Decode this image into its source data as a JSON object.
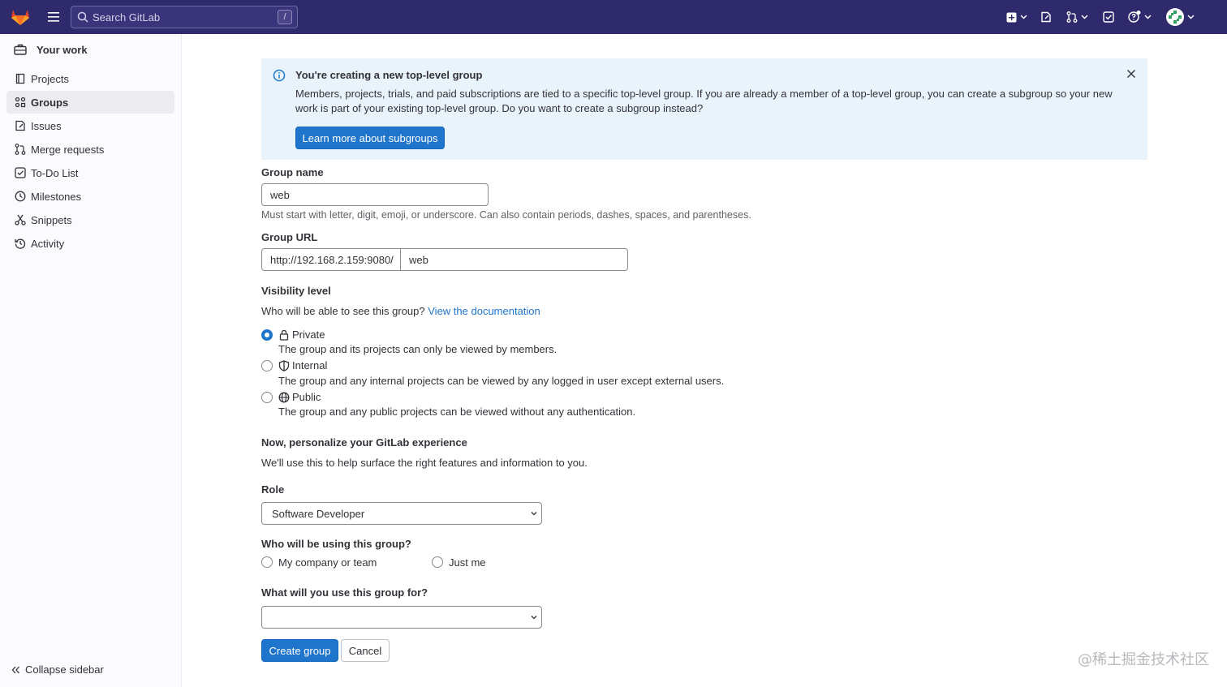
{
  "topbar": {
    "search_placeholder": "Search GitLab",
    "search_shortcut": "/",
    "icons": [
      "gitlab-logo",
      "hamburger-icon",
      "plus-square-icon",
      "issues-icon",
      "merge-request-icon",
      "todo-icon",
      "help-icon",
      "avatar"
    ]
  },
  "sidebar": {
    "header": "Your work",
    "items": [
      {
        "label": "Projects",
        "icon": "project-icon"
      },
      {
        "label": "Groups",
        "icon": "group-icon",
        "active": true
      },
      {
        "label": "Issues",
        "icon": "issues-icon"
      },
      {
        "label": "Merge requests",
        "icon": "merge-request-icon"
      },
      {
        "label": "To-Do List",
        "icon": "todo-icon"
      },
      {
        "label": "Milestones",
        "icon": "clock-icon"
      },
      {
        "label": "Snippets",
        "icon": "snippet-icon"
      },
      {
        "label": "Activity",
        "icon": "history-icon"
      }
    ],
    "collapse_label": "Collapse sidebar"
  },
  "alert": {
    "title": "You're creating a new top-level group",
    "body": "Members, projects, trials, and paid subscriptions are tied to a specific top-level group. If you are already a member of a top-level group, you can create a subgroup so your new work is part of your existing top-level group. Do you want to create a subgroup instead?",
    "button": "Learn more about subgroups"
  },
  "form": {
    "group_name_label": "Group name",
    "group_name_value": "web",
    "group_name_help": "Must start with letter, digit, emoji, or underscore. Can also contain periods, dashes, spaces, and parentheses.",
    "group_url_label": "Group URL",
    "group_url_prefix": "http://192.168.2.159:9080/",
    "group_url_value": "web",
    "visibility_label": "Visibility level",
    "visibility_question": "Who will be able to see this group?",
    "visibility_link": "View the documentation",
    "visibility_options": [
      {
        "label": "Private",
        "description": "The group and its projects can only be viewed by members.",
        "checked": true,
        "icon": "lock-icon"
      },
      {
        "label": "Internal",
        "description": "The group and any internal projects can be viewed by any logged in user except external users.",
        "checked": false,
        "icon": "shield-icon"
      },
      {
        "label": "Public",
        "description": "The group and any public projects can be viewed without any authentication.",
        "checked": false,
        "icon": "globe-icon"
      }
    ],
    "personalize_title": "Now, personalize your GitLab experience",
    "personalize_help": "We'll use this to help surface the right features and information to you.",
    "role_label": "Role",
    "role_value": "Software Developer",
    "using_label": "Who will be using this group?",
    "using_options": [
      {
        "label": "My company or team",
        "checked": false
      },
      {
        "label": "Just me",
        "checked": false
      }
    ],
    "purpose_label": "What will you use this group for?",
    "purpose_value": "",
    "create_button": "Create group",
    "cancel_button": "Cancel"
  },
  "watermark": "@稀土掘金技术社区",
  "colors": {
    "topbar": "#2f2a6b",
    "primary": "#1f75cb",
    "alert_bg": "#e9f3fc",
    "sidebar_bg": "#fbfafd"
  }
}
